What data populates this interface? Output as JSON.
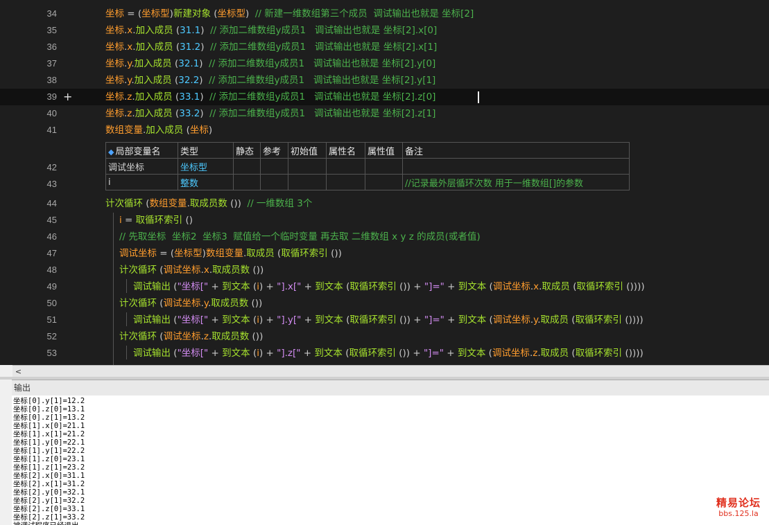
{
  "editor": {
    "lines": [
      {
        "num": "34",
        "indent": 0,
        "parts": [
          {
            "c": "var",
            "t": "坐标"
          },
          {
            "c": "op",
            "t": " = ("
          },
          {
            "c": "var",
            "t": "坐标型"
          },
          {
            "c": "op",
            "t": ")"
          },
          {
            "c": "fn",
            "t": "新建对象"
          },
          {
            "c": "op",
            "t": " ("
          },
          {
            "c": "var",
            "t": "坐标型"
          },
          {
            "c": "op",
            "t": ")  "
          },
          {
            "c": "cmt",
            "t": "// 新建一维数组第三个成员  调试输出也就是 坐标[2]"
          }
        ]
      },
      {
        "num": "35",
        "indent": 0,
        "parts": [
          {
            "c": "var",
            "t": "坐标"
          },
          {
            "c": "op",
            "t": "."
          },
          {
            "c": "var",
            "t": "x"
          },
          {
            "c": "op",
            "t": "."
          },
          {
            "c": "fn",
            "t": "加入成员"
          },
          {
            "c": "op",
            "t": " ("
          },
          {
            "c": "num",
            "t": "31.1"
          },
          {
            "c": "op",
            "t": ")  "
          },
          {
            "c": "cmt",
            "t": "// 添加二维数组y成员1   调试输出也就是 坐标[2].x[0]"
          }
        ]
      },
      {
        "num": "36",
        "indent": 0,
        "parts": [
          {
            "c": "var",
            "t": "坐标"
          },
          {
            "c": "op",
            "t": "."
          },
          {
            "c": "var",
            "t": "x"
          },
          {
            "c": "op",
            "t": "."
          },
          {
            "c": "fn",
            "t": "加入成员"
          },
          {
            "c": "op",
            "t": " ("
          },
          {
            "c": "num",
            "t": "31.2"
          },
          {
            "c": "op",
            "t": ")  "
          },
          {
            "c": "cmt",
            "t": "// 添加二维数组y成员1   调试输出也就是 坐标[2].x[1]"
          }
        ]
      },
      {
        "num": "37",
        "indent": 0,
        "parts": [
          {
            "c": "var",
            "t": "坐标"
          },
          {
            "c": "op",
            "t": "."
          },
          {
            "c": "var",
            "t": "y"
          },
          {
            "c": "op",
            "t": "."
          },
          {
            "c": "fn",
            "t": "加入成员"
          },
          {
            "c": "op",
            "t": " ("
          },
          {
            "c": "num",
            "t": "32.1"
          },
          {
            "c": "op",
            "t": ")  "
          },
          {
            "c": "cmt",
            "t": "// 添加二维数组y成员1   调试输出也就是 坐标[2].y[0]"
          }
        ]
      },
      {
        "num": "38",
        "indent": 0,
        "parts": [
          {
            "c": "var",
            "t": "坐标"
          },
          {
            "c": "op",
            "t": "."
          },
          {
            "c": "var",
            "t": "y"
          },
          {
            "c": "op",
            "t": "."
          },
          {
            "c": "fn",
            "t": "加入成员"
          },
          {
            "c": "op",
            "t": " ("
          },
          {
            "c": "num",
            "t": "32.2"
          },
          {
            "c": "op",
            "t": ")  "
          },
          {
            "c": "cmt",
            "t": "// 添加二维数组y成员1   调试输出也就是 坐标[2].y[1]"
          }
        ]
      },
      {
        "num": "39",
        "indent": 0,
        "current": true,
        "parts": [
          {
            "c": "var",
            "t": "坐标"
          },
          {
            "c": "op",
            "t": "."
          },
          {
            "c": "var",
            "t": "z"
          },
          {
            "c": "op",
            "t": "."
          },
          {
            "c": "fn",
            "t": "加入成员"
          },
          {
            "c": "op",
            "t": " ("
          },
          {
            "c": "num",
            "t": "33.1"
          },
          {
            "c": "op",
            "t": ")  "
          },
          {
            "c": "cmt",
            "t": "// 添加二维数组y成员1   调试输出也就是 坐标[2].z[0]"
          }
        ]
      },
      {
        "num": "40",
        "indent": 0,
        "parts": [
          {
            "c": "var",
            "t": "坐标"
          },
          {
            "c": "op",
            "t": "."
          },
          {
            "c": "var",
            "t": "z"
          },
          {
            "c": "op",
            "t": "."
          },
          {
            "c": "fn",
            "t": "加入成员"
          },
          {
            "c": "op",
            "t": " ("
          },
          {
            "c": "num",
            "t": "33.2"
          },
          {
            "c": "op",
            "t": ")  "
          },
          {
            "c": "cmt",
            "t": "// 添加二维数组y成员1   调试输出也就是 坐标[2].z[1]"
          }
        ]
      },
      {
        "num": "41",
        "indent": 0,
        "parts": [
          {
            "c": "var",
            "t": "数组变量"
          },
          {
            "c": "op",
            "t": "."
          },
          {
            "c": "fn",
            "t": "加入成员"
          },
          {
            "c": "op",
            "t": " ("
          },
          {
            "c": "var",
            "t": "坐标"
          },
          {
            "c": "op",
            "t": ")"
          }
        ]
      },
      {
        "num": "44",
        "indent": 0,
        "parts": [
          {
            "c": "fn",
            "t": "计次循环"
          },
          {
            "c": "op",
            "t": " ("
          },
          {
            "c": "var",
            "t": "数组变量"
          },
          {
            "c": "op",
            "t": "."
          },
          {
            "c": "fn",
            "t": "取成员数"
          },
          {
            "c": "op",
            "t": " ())  "
          },
          {
            "c": "cmt",
            "t": "// 一维数组 3个"
          }
        ]
      },
      {
        "num": "45",
        "indent": 1,
        "parts": [
          {
            "c": "var",
            "t": "i"
          },
          {
            "c": "op",
            "t": " = "
          },
          {
            "c": "fn",
            "t": "取循环索引"
          },
          {
            "c": "op",
            "t": " ()"
          }
        ]
      },
      {
        "num": "46",
        "indent": 1,
        "parts": [
          {
            "c": "cmt",
            "t": "// 先取坐标  坐标2  坐标3  赋值给一个临时变量 再去取 二维数组 x y z 的成员(或者值)"
          }
        ]
      },
      {
        "num": "47",
        "indent": 1,
        "parts": [
          {
            "c": "var",
            "t": "调试坐标"
          },
          {
            "c": "op",
            "t": " = ("
          },
          {
            "c": "var",
            "t": "坐标型"
          },
          {
            "c": "op",
            "t": ")"
          },
          {
            "c": "var",
            "t": "数组变量"
          },
          {
            "c": "op",
            "t": "."
          },
          {
            "c": "fn",
            "t": "取成员"
          },
          {
            "c": "op",
            "t": " ("
          },
          {
            "c": "fn",
            "t": "取循环索引"
          },
          {
            "c": "op",
            "t": " ())"
          }
        ]
      },
      {
        "num": "48",
        "indent": 1,
        "parts": [
          {
            "c": "fn",
            "t": "计次循环"
          },
          {
            "c": "op",
            "t": " ("
          },
          {
            "c": "var",
            "t": "调试坐标"
          },
          {
            "c": "op",
            "t": "."
          },
          {
            "c": "var",
            "t": "x"
          },
          {
            "c": "op",
            "t": "."
          },
          {
            "c": "fn",
            "t": "取成员数"
          },
          {
            "c": "op",
            "t": " ())"
          }
        ]
      },
      {
        "num": "49",
        "indent": 2,
        "parts": [
          {
            "c": "fn",
            "t": "调试输出"
          },
          {
            "c": "op",
            "t": " ("
          },
          {
            "c": "str",
            "t": "\"坐标[\""
          },
          {
            "c": "op",
            "t": " + "
          },
          {
            "c": "fn",
            "t": "到文本"
          },
          {
            "c": "op",
            "t": " ("
          },
          {
            "c": "var",
            "t": "i"
          },
          {
            "c": "op",
            "t": ") + "
          },
          {
            "c": "str",
            "t": "\"].x[\""
          },
          {
            "c": "op",
            "t": " + "
          },
          {
            "c": "fn",
            "t": "到文本"
          },
          {
            "c": "op",
            "t": " ("
          },
          {
            "c": "fn",
            "t": "取循环索引"
          },
          {
            "c": "op",
            "t": " ()) + "
          },
          {
            "c": "str",
            "t": "\"]=\""
          },
          {
            "c": "op",
            "t": " + "
          },
          {
            "c": "fn",
            "t": "到文本"
          },
          {
            "c": "op",
            "t": " ("
          },
          {
            "c": "var",
            "t": "调试坐标"
          },
          {
            "c": "op",
            "t": "."
          },
          {
            "c": "var",
            "t": "x"
          },
          {
            "c": "op",
            "t": "."
          },
          {
            "c": "fn",
            "t": "取成员"
          },
          {
            "c": "op",
            "t": " ("
          },
          {
            "c": "fn",
            "t": "取循环索引"
          },
          {
            "c": "op",
            "t": " ())))"
          }
        ]
      },
      {
        "num": "50",
        "indent": 1,
        "parts": [
          {
            "c": "fn",
            "t": "计次循环"
          },
          {
            "c": "op",
            "t": " ("
          },
          {
            "c": "var",
            "t": "调试坐标"
          },
          {
            "c": "op",
            "t": "."
          },
          {
            "c": "var",
            "t": "y"
          },
          {
            "c": "op",
            "t": "."
          },
          {
            "c": "fn",
            "t": "取成员数"
          },
          {
            "c": "op",
            "t": " ())"
          }
        ]
      },
      {
        "num": "51",
        "indent": 2,
        "parts": [
          {
            "c": "fn",
            "t": "调试输出"
          },
          {
            "c": "op",
            "t": " ("
          },
          {
            "c": "str",
            "t": "\"坐标[\""
          },
          {
            "c": "op",
            "t": " + "
          },
          {
            "c": "fn",
            "t": "到文本"
          },
          {
            "c": "op",
            "t": " ("
          },
          {
            "c": "var",
            "t": "i"
          },
          {
            "c": "op",
            "t": ") + "
          },
          {
            "c": "str",
            "t": "\"].y[\""
          },
          {
            "c": "op",
            "t": " + "
          },
          {
            "c": "fn",
            "t": "到文本"
          },
          {
            "c": "op",
            "t": " ("
          },
          {
            "c": "fn",
            "t": "取循环索引"
          },
          {
            "c": "op",
            "t": " ()) + "
          },
          {
            "c": "str",
            "t": "\"]=\""
          },
          {
            "c": "op",
            "t": " + "
          },
          {
            "c": "fn",
            "t": "到文本"
          },
          {
            "c": "op",
            "t": " ("
          },
          {
            "c": "var",
            "t": "调试坐标"
          },
          {
            "c": "op",
            "t": "."
          },
          {
            "c": "var",
            "t": "y"
          },
          {
            "c": "op",
            "t": "."
          },
          {
            "c": "fn",
            "t": "取成员"
          },
          {
            "c": "op",
            "t": " ("
          },
          {
            "c": "fn",
            "t": "取循环索引"
          },
          {
            "c": "op",
            "t": " ())))"
          }
        ]
      },
      {
        "num": "52",
        "indent": 1,
        "parts": [
          {
            "c": "fn",
            "t": "计次循环"
          },
          {
            "c": "op",
            "t": " ("
          },
          {
            "c": "var",
            "t": "调试坐标"
          },
          {
            "c": "op",
            "t": "."
          },
          {
            "c": "var",
            "t": "z"
          },
          {
            "c": "op",
            "t": "."
          },
          {
            "c": "fn",
            "t": "取成员数"
          },
          {
            "c": "op",
            "t": " ())"
          }
        ]
      },
      {
        "num": "53",
        "indent": 2,
        "parts": [
          {
            "c": "fn",
            "t": "调试输出"
          },
          {
            "c": "op",
            "t": " ("
          },
          {
            "c": "str",
            "t": "\"坐标[\""
          },
          {
            "c": "op",
            "t": " + "
          },
          {
            "c": "fn",
            "t": "到文本"
          },
          {
            "c": "op",
            "t": " ("
          },
          {
            "c": "var",
            "t": "i"
          },
          {
            "c": "op",
            "t": ") + "
          },
          {
            "c": "str",
            "t": "\"].z[\""
          },
          {
            "c": "op",
            "t": " + "
          },
          {
            "c": "fn",
            "t": "到文本"
          },
          {
            "c": "op",
            "t": " ("
          },
          {
            "c": "fn",
            "t": "取循环索引"
          },
          {
            "c": "op",
            "t": " ()) + "
          },
          {
            "c": "str",
            "t": "\"]=\""
          },
          {
            "c": "op",
            "t": " + "
          },
          {
            "c": "fn",
            "t": "到文本"
          },
          {
            "c": "op",
            "t": " ("
          },
          {
            "c": "var",
            "t": "调试坐标"
          },
          {
            "c": "op",
            "t": "."
          },
          {
            "c": "var",
            "t": "z"
          },
          {
            "c": "op",
            "t": "."
          },
          {
            "c": "fn",
            "t": "取成员"
          },
          {
            "c": "op",
            "t": " ("
          },
          {
            "c": "fn",
            "t": "取循环索引"
          },
          {
            "c": "op",
            "t": " ())))"
          }
        ]
      }
    ],
    "current_line_marker": "+",
    "var_table": {
      "headers": [
        "局部变量名",
        "类型",
        "静态",
        "参考",
        "初始值",
        "属性名",
        "属性值",
        "备注"
      ],
      "rows": [
        {
          "num": "42",
          "cells": [
            "调试坐标",
            "坐标型",
            "",
            "",
            "",
            "",
            "",
            ""
          ]
        },
        {
          "num": "43",
          "cells": [
            "i",
            "整数",
            "",
            "",
            "",
            "",
            "",
            "//记录最外层循环次数  用于一维数组[]的参数"
          ]
        }
      ]
    }
  },
  "scrollbar": {
    "left_arrow": "<"
  },
  "output": {
    "title": "输出",
    "lines": [
      "坐标[0].y[1]=12.2",
      "坐标[0].z[0]=13.1",
      "坐标[0].z[1]=13.2",
      "坐标[1].x[0]=21.1",
      "坐标[1].x[1]=21.2",
      "坐标[1].y[0]=22.1",
      "坐标[1].y[1]=22.2",
      "坐标[1].z[0]=23.1",
      "坐标[1].z[1]=23.2",
      "坐标[2].x[0]=31.1",
      "坐标[2].x[1]=31.2",
      "坐标[2].y[0]=32.1",
      "坐标[2].y[1]=32.2",
      "坐标[2].z[0]=33.1",
      "坐标[2].z[1]=33.2",
      "被调试程序已经退出"
    ]
  },
  "watermark": {
    "line1": "精易论坛",
    "line2": "bbs.125.la"
  },
  "colors": {
    "editor_bg": "#1e1e1e",
    "function": "#a6e22e",
    "variable": "#ff9d2e",
    "number": "#4dc9ff",
    "comment": "#4cb24c",
    "string": "#d18bf0",
    "watermark": "#e0301e"
  }
}
